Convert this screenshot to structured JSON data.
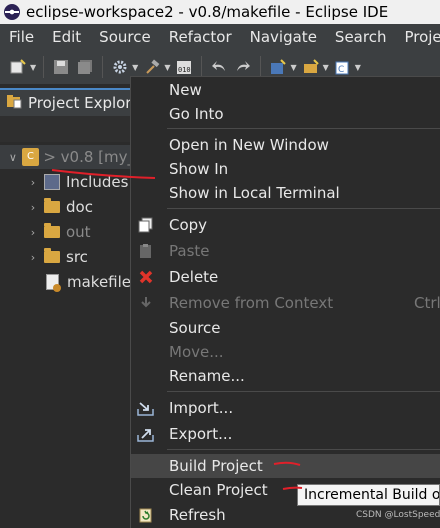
{
  "window": {
    "title": "eclipse-workspace2 - v0.8/makefile - Eclipse IDE"
  },
  "menubar": {
    "items": [
      "File",
      "Edit",
      "Source",
      "Refactor",
      "Navigate",
      "Search",
      "Proje"
    ]
  },
  "explorer": {
    "title": "Project Explor",
    "tree": [
      {
        "label": "> v0.8 [my_",
        "kind": "project",
        "dim": true
      },
      {
        "label": "Includes",
        "kind": "includes"
      },
      {
        "label": "doc",
        "kind": "folder"
      },
      {
        "label": "out",
        "kind": "folder",
        "dim": true
      },
      {
        "label": "src",
        "kind": "folder"
      },
      {
        "label": "makefile",
        "kind": "file"
      }
    ]
  },
  "context_menu": {
    "items": [
      {
        "label": "New"
      },
      {
        "label": "Go Into"
      },
      {
        "label": "Open in New Window"
      },
      {
        "label": "Show In"
      },
      {
        "label": "Show in Local Terminal"
      },
      {
        "label": "Copy",
        "icon": "copy-icon"
      },
      {
        "label": "Paste",
        "icon": "paste-icon",
        "disabled": true
      },
      {
        "label": "Delete",
        "icon": "delete-icon"
      },
      {
        "label": "Remove from Context",
        "icon": "remove-context-icon",
        "disabled": true,
        "shortcut": "Ctrl"
      },
      {
        "label": "Source"
      },
      {
        "label": "Move...",
        "disabled": true
      },
      {
        "label": "Rename..."
      },
      {
        "label": "Import...",
        "icon": "import-icon"
      },
      {
        "label": "Export...",
        "icon": "export-icon"
      },
      {
        "label": "Build Project",
        "highlighted": true
      },
      {
        "label": "Clean Project"
      },
      {
        "label": "Refresh",
        "icon": "refresh-icon"
      }
    ]
  },
  "tooltip": {
    "text": "Incremental Build o"
  },
  "watermark": {
    "text": "CSDN @LostSpeed"
  },
  "colors": {
    "menu_bg": "#2b2b2b",
    "highlight": "#464646",
    "annotation": "#e0202a",
    "accent": "#4a88c7"
  }
}
